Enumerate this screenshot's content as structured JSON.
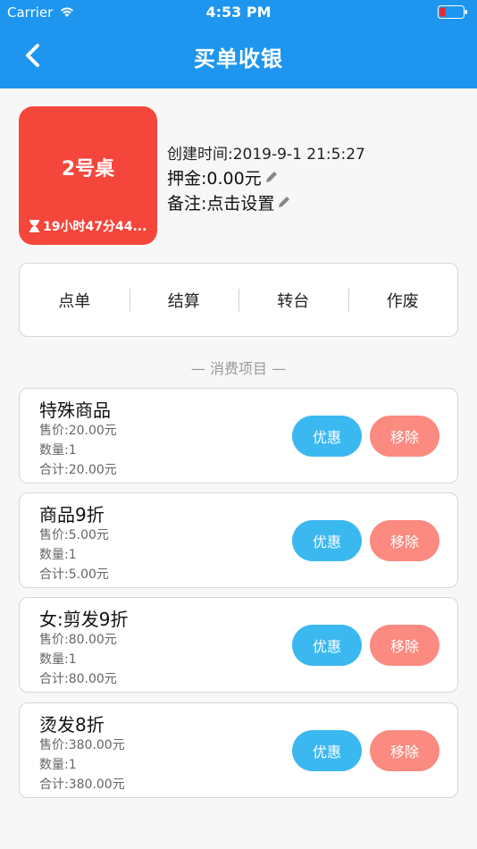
{
  "status_bar": {
    "carrier": "Carrier",
    "time": "4:53 PM"
  },
  "nav": {
    "title": "买单收银",
    "back_icon": "chevron-left-icon"
  },
  "table": {
    "name": "2号桌",
    "timer": "19小时47分44...",
    "created": "创建时间:2019-9-1 21:5:27",
    "deposit": "押金:0.00元",
    "note": "备注:点击设置"
  },
  "actions": [
    "点单",
    "结算",
    "转台",
    "作废"
  ],
  "section_label": "— 消费项目 —",
  "items": [
    {
      "name": "特殊商品",
      "price": "售价:20.00元",
      "qty": "数量:1",
      "total": "合计:20.00元"
    },
    {
      "name": "商品9折",
      "price": "售价:5.00元",
      "qty": "数量:1",
      "total": "合计:5.00元"
    },
    {
      "name": "女:剪发9折",
      "price": "售价:80.00元",
      "qty": "数量:1",
      "total": "合计:80.00元"
    },
    {
      "name": "烫发8折",
      "price": "售价:380.00元",
      "qty": "数量:1",
      "total": "合计:380.00元"
    }
  ],
  "item_buttons": {
    "discount": "优惠",
    "remove": "移除"
  },
  "colors": {
    "header": "#1e96f0",
    "table_card": "#f5463c",
    "discount": "#3cb8f0",
    "remove": "#fb8a80"
  }
}
